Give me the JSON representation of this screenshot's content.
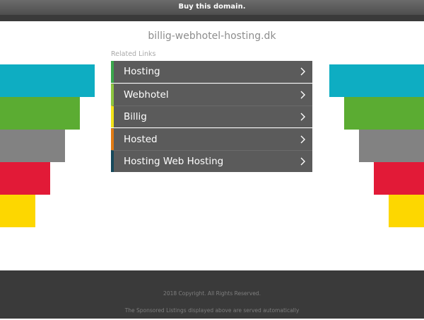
{
  "topbar": {
    "label": "Buy this domain."
  },
  "domain": "billig-webhotel-hosting.dk",
  "related": {
    "heading": "Related Links",
    "items": [
      {
        "label": "Hosting",
        "accent": "#3aa64b"
      },
      {
        "label": "Webhotel",
        "accent": "#8dc63f"
      },
      {
        "label": "Billig",
        "accent": "#f2e318"
      },
      {
        "label": "Hosted",
        "accent": "#e07a13"
      },
      {
        "label": "Hosting Web Hosting",
        "accent": "#17495b"
      }
    ]
  },
  "decor": {
    "colors": [
      "#0eadc2",
      "#5bac32",
      "#828282",
      "#e21a37",
      "#fdd700"
    ]
  },
  "footer": {
    "copyright": "2018 Copyright. All Rights Reserved.",
    "disclaimer": "The Sponsored Listings displayed above are served automatically"
  }
}
